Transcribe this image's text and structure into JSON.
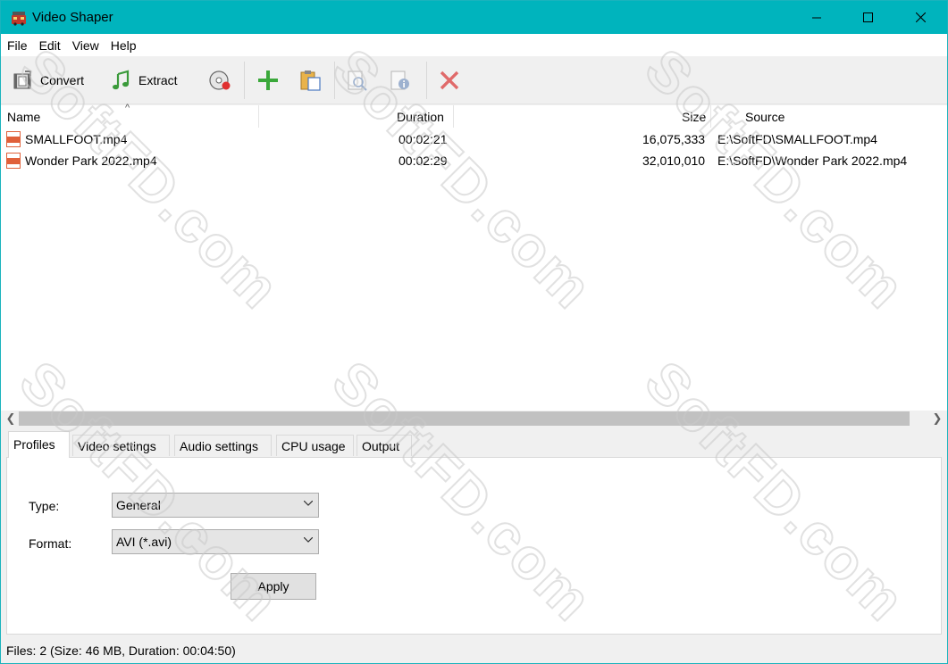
{
  "window": {
    "title": "Video Shaper"
  },
  "menu": [
    "File",
    "Edit",
    "View",
    "Help"
  ],
  "toolbar": {
    "convert_label": "Convert",
    "extract_label": "Extract"
  },
  "list": {
    "columns": {
      "name": "Name",
      "duration": "Duration",
      "size": "Size",
      "source": "Source"
    },
    "rows": [
      {
        "name": "SMALLFOOT.mp4",
        "duration": "00:02:21",
        "size": "16,075,333",
        "source": "E:\\SoftFD\\SMALLFOOT.mp4"
      },
      {
        "name": "Wonder Park 2022.mp4",
        "duration": "00:02:29",
        "size": "32,010,010",
        "source": "E:\\SoftFD\\Wonder Park 2022.mp4"
      }
    ]
  },
  "tabs": [
    "Profiles",
    "Video settings",
    "Audio settings",
    "CPU usage",
    "Output"
  ],
  "profiles": {
    "type_label": "Type:",
    "type_value": "General",
    "format_label": "Format:",
    "format_value": "AVI (*.avi)",
    "apply_label": "Apply"
  },
  "status": "Files: 2 (Size: 46 MB, Duration: 00:04:50)",
  "watermark": "SoftFD.com",
  "colors": {
    "titlebar": "#00b4bd",
    "add_icon": "#3aa83a",
    "delete_icon": "#e06a6a"
  }
}
